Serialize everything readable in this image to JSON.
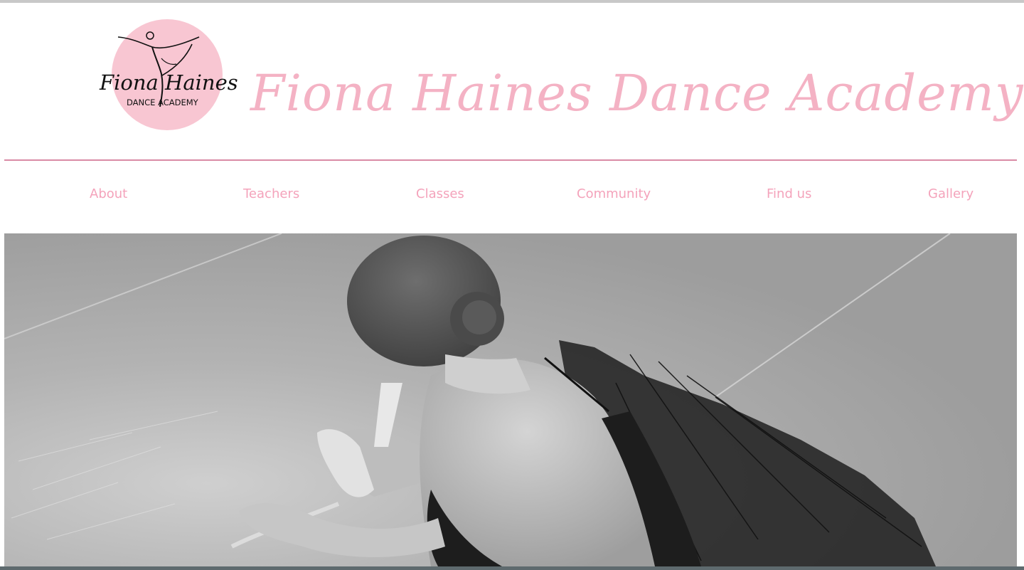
{
  "site": {
    "title": "Fiona Haines Dance Academy"
  },
  "logo": {
    "text_line1": "Fiona Haines",
    "text_line2": "DANCE ACADEMY",
    "circle_color": "#f8c6d2"
  },
  "nav": {
    "items": [
      {
        "label": "About"
      },
      {
        "label": "Teachers"
      },
      {
        "label": "Classes"
      },
      {
        "label": "Community"
      },
      {
        "label": "Find us"
      },
      {
        "label": "Gallery"
      }
    ]
  },
  "hero": {
    "description_icon": "ballet-dancer-photo"
  },
  "colors": {
    "accent_pink": "#f4a3bb",
    "title_pink": "#f4b2c4",
    "divider": "#d98aa5"
  }
}
